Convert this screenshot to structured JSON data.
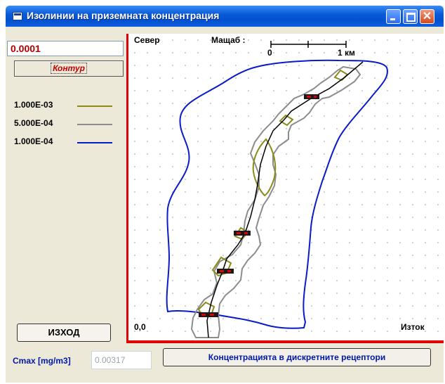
{
  "window": {
    "title": "Изолинии на приземната концентрация",
    "close_glyph": "✕"
  },
  "left_panel": {
    "value_field": "0.0001",
    "contour_button": "Контур",
    "legend": [
      {
        "label": "1.000E-03",
        "color": "#8b8b1c"
      },
      {
        "label": "5.000E-04",
        "color": "#8c8c8c"
      },
      {
        "label": "1.000E-04",
        "color": "#0a1cc8"
      }
    ],
    "exit_button": "ИЗХОД"
  },
  "plot": {
    "north_label": "Север",
    "scale_label": "Мащаб :",
    "scale_start": "0",
    "scale_end": "1 км",
    "origin_label": "0,0",
    "east_label": "Изток"
  },
  "bottom": {
    "cmax_label": "Cmax [mg/m3]",
    "cmax_value": "0.00317",
    "receptors_button": "Концентрацията в дискретните рецептори"
  }
}
